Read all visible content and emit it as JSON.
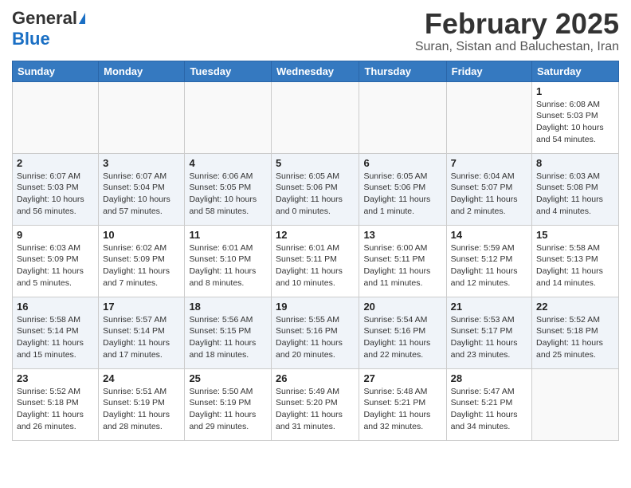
{
  "header": {
    "logo_general": "General",
    "logo_blue": "Blue",
    "month_title": "February 2025",
    "location": "Suran, Sistan and Baluchestan, Iran"
  },
  "weekdays": [
    "Sunday",
    "Monday",
    "Tuesday",
    "Wednesday",
    "Thursday",
    "Friday",
    "Saturday"
  ],
  "weeks": [
    [
      {
        "day": "",
        "info": ""
      },
      {
        "day": "",
        "info": ""
      },
      {
        "day": "",
        "info": ""
      },
      {
        "day": "",
        "info": ""
      },
      {
        "day": "",
        "info": ""
      },
      {
        "day": "",
        "info": ""
      },
      {
        "day": "1",
        "info": "Sunrise: 6:08 AM\nSunset: 5:03 PM\nDaylight: 10 hours\nand 54 minutes."
      }
    ],
    [
      {
        "day": "2",
        "info": "Sunrise: 6:07 AM\nSunset: 5:03 PM\nDaylight: 10 hours\nand 56 minutes."
      },
      {
        "day": "3",
        "info": "Sunrise: 6:07 AM\nSunset: 5:04 PM\nDaylight: 10 hours\nand 57 minutes."
      },
      {
        "day": "4",
        "info": "Sunrise: 6:06 AM\nSunset: 5:05 PM\nDaylight: 10 hours\nand 58 minutes."
      },
      {
        "day": "5",
        "info": "Sunrise: 6:05 AM\nSunset: 5:06 PM\nDaylight: 11 hours\nand 0 minutes."
      },
      {
        "day": "6",
        "info": "Sunrise: 6:05 AM\nSunset: 5:06 PM\nDaylight: 11 hours\nand 1 minute."
      },
      {
        "day": "7",
        "info": "Sunrise: 6:04 AM\nSunset: 5:07 PM\nDaylight: 11 hours\nand 2 minutes."
      },
      {
        "day": "8",
        "info": "Sunrise: 6:03 AM\nSunset: 5:08 PM\nDaylight: 11 hours\nand 4 minutes."
      }
    ],
    [
      {
        "day": "9",
        "info": "Sunrise: 6:03 AM\nSunset: 5:09 PM\nDaylight: 11 hours\nand 5 minutes."
      },
      {
        "day": "10",
        "info": "Sunrise: 6:02 AM\nSunset: 5:09 PM\nDaylight: 11 hours\nand 7 minutes."
      },
      {
        "day": "11",
        "info": "Sunrise: 6:01 AM\nSunset: 5:10 PM\nDaylight: 11 hours\nand 8 minutes."
      },
      {
        "day": "12",
        "info": "Sunrise: 6:01 AM\nSunset: 5:11 PM\nDaylight: 11 hours\nand 10 minutes."
      },
      {
        "day": "13",
        "info": "Sunrise: 6:00 AM\nSunset: 5:11 PM\nDaylight: 11 hours\nand 11 minutes."
      },
      {
        "day": "14",
        "info": "Sunrise: 5:59 AM\nSunset: 5:12 PM\nDaylight: 11 hours\nand 12 minutes."
      },
      {
        "day": "15",
        "info": "Sunrise: 5:58 AM\nSunset: 5:13 PM\nDaylight: 11 hours\nand 14 minutes."
      }
    ],
    [
      {
        "day": "16",
        "info": "Sunrise: 5:58 AM\nSunset: 5:14 PM\nDaylight: 11 hours\nand 15 minutes."
      },
      {
        "day": "17",
        "info": "Sunrise: 5:57 AM\nSunset: 5:14 PM\nDaylight: 11 hours\nand 17 minutes."
      },
      {
        "day": "18",
        "info": "Sunrise: 5:56 AM\nSunset: 5:15 PM\nDaylight: 11 hours\nand 18 minutes."
      },
      {
        "day": "19",
        "info": "Sunrise: 5:55 AM\nSunset: 5:16 PM\nDaylight: 11 hours\nand 20 minutes."
      },
      {
        "day": "20",
        "info": "Sunrise: 5:54 AM\nSunset: 5:16 PM\nDaylight: 11 hours\nand 22 minutes."
      },
      {
        "day": "21",
        "info": "Sunrise: 5:53 AM\nSunset: 5:17 PM\nDaylight: 11 hours\nand 23 minutes."
      },
      {
        "day": "22",
        "info": "Sunrise: 5:52 AM\nSunset: 5:18 PM\nDaylight: 11 hours\nand 25 minutes."
      }
    ],
    [
      {
        "day": "23",
        "info": "Sunrise: 5:52 AM\nSunset: 5:18 PM\nDaylight: 11 hours\nand 26 minutes."
      },
      {
        "day": "24",
        "info": "Sunrise: 5:51 AM\nSunset: 5:19 PM\nDaylight: 11 hours\nand 28 minutes."
      },
      {
        "day": "25",
        "info": "Sunrise: 5:50 AM\nSunset: 5:19 PM\nDaylight: 11 hours\nand 29 minutes."
      },
      {
        "day": "26",
        "info": "Sunrise: 5:49 AM\nSunset: 5:20 PM\nDaylight: 11 hours\nand 31 minutes."
      },
      {
        "day": "27",
        "info": "Sunrise: 5:48 AM\nSunset: 5:21 PM\nDaylight: 11 hours\nand 32 minutes."
      },
      {
        "day": "28",
        "info": "Sunrise: 5:47 AM\nSunset: 5:21 PM\nDaylight: 11 hours\nand 34 minutes."
      },
      {
        "day": "",
        "info": ""
      }
    ]
  ]
}
